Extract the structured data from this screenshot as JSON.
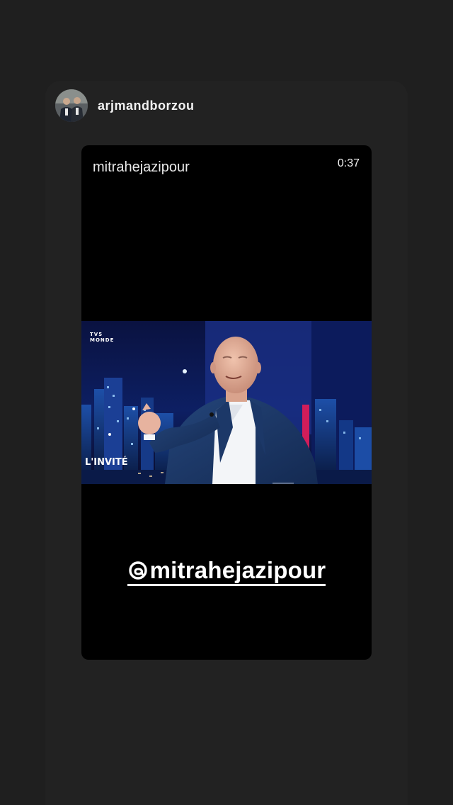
{
  "shared_post": {
    "username": "arjmandborzou",
    "avatar_icon": "profile-avatar"
  },
  "story": {
    "author": "mitrahejazipour",
    "duration": "0:37",
    "video": {
      "channel_line1": "TV5",
      "channel_line2": "MONDE",
      "show_logo": "L'INVITÉ"
    },
    "mention": {
      "icon": "threads-icon",
      "text": "mitrahejazipour"
    }
  },
  "colors": {
    "background": "#1f1f1f",
    "card": "#222222",
    "story_bg": "#000000",
    "text": "#ffffff"
  }
}
